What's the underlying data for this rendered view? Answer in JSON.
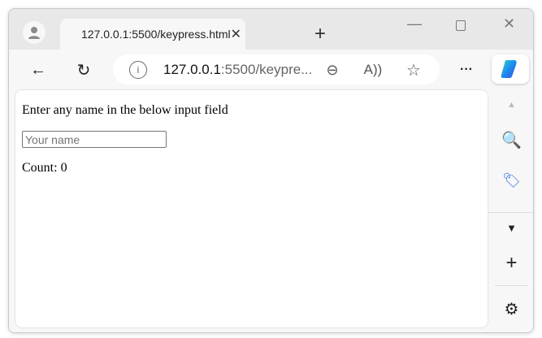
{
  "tab": {
    "title": "127.0.0.1:5500/keypress.html"
  },
  "address": {
    "host": "127.0.0.1",
    "rest": ":5500/keypre..."
  },
  "page": {
    "heading": "Enter any name in the below input field",
    "input_placeholder": "Your name",
    "input_value": "",
    "count_label": "Count: 0"
  },
  "icons": [
    "profile-icon",
    "page-icon",
    "close-icon",
    "plus-icon",
    "minimize-icon",
    "maximize-icon",
    "back-icon",
    "refresh-icon",
    "info-icon",
    "zoom-out-icon",
    "read-aloud-icon",
    "favorite-icon",
    "more-icon",
    "copilot-icon",
    "search-icon",
    "tag-icon",
    "chevron-down-icon",
    "settings-icon"
  ]
}
